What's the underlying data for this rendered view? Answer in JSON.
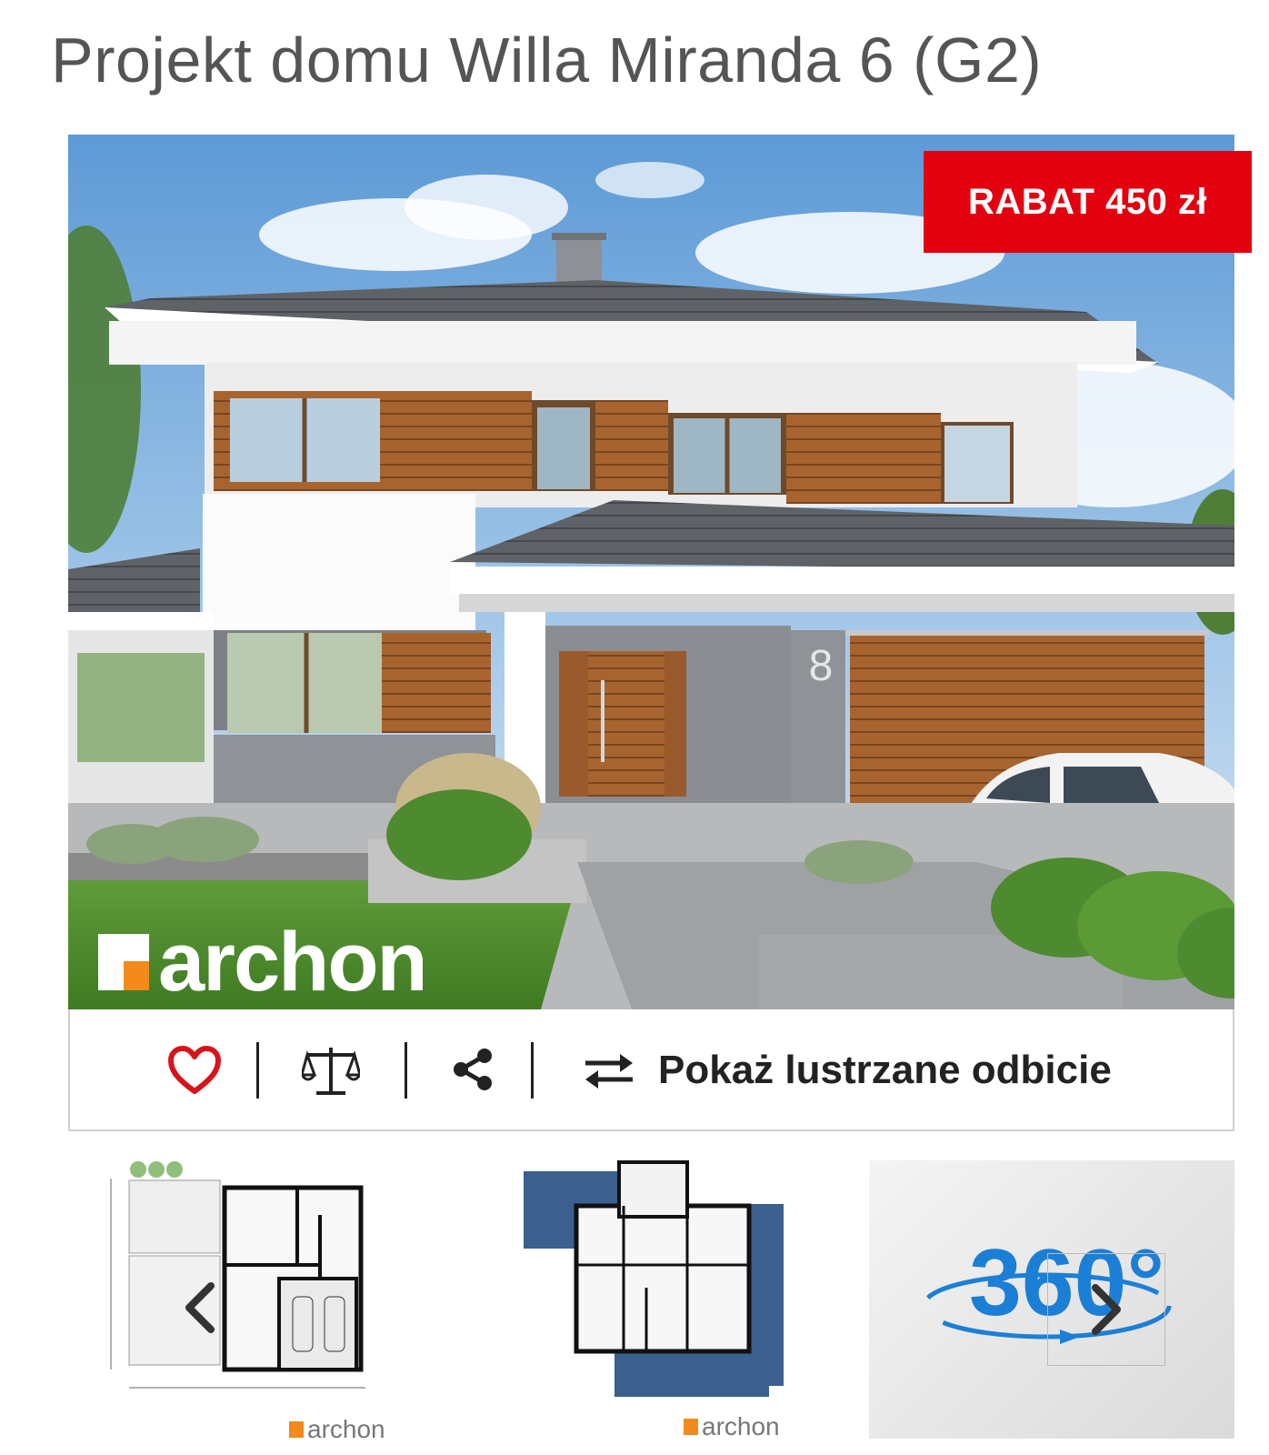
{
  "page": {
    "title": "Projekt domu Willa Miranda 6 (G2)"
  },
  "hero": {
    "badge": "RABAT 450 zł",
    "brand": "archon",
    "house_number": "8"
  },
  "actions": {
    "favorite_icon": "heart-icon",
    "compare_icon": "scale-icon",
    "share_icon": "share-icon",
    "mirror_icon": "swap-arrows-icon",
    "mirror_label": "Pokaż lustrzane odbicie"
  },
  "thumbnails": {
    "items": [
      {
        "kind": "floor-plan-ground",
        "brand": "archon"
      },
      {
        "kind": "floor-plan-upper",
        "brand": "archon"
      },
      {
        "kind": "360-view",
        "label": "360°"
      }
    ],
    "prev_icon": "chevron-left-icon",
    "next_icon": "chevron-right-icon"
  },
  "colors": {
    "badge_bg": "#e3000f",
    "heart": "#d7141a",
    "brand_orange": "#f28a1c",
    "view360_blue": "#1c7fd6",
    "title_text": "#555555"
  }
}
